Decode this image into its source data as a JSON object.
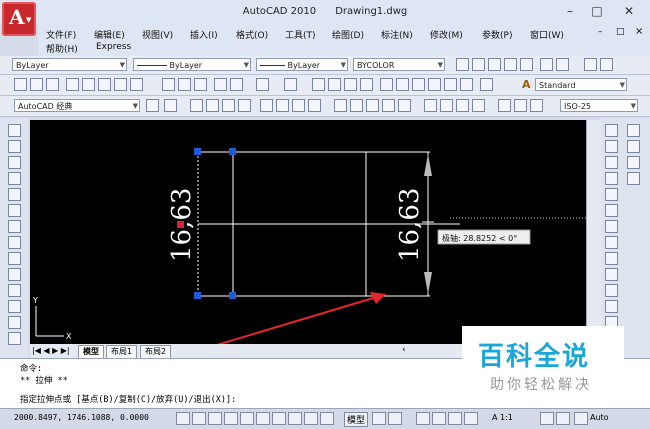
{
  "window": {
    "app_logo_letter": "A",
    "title": "AutoCAD 2010",
    "document": "Drawing1.dwg",
    "btn_minimize": "–",
    "btn_maximize": "□",
    "btn_close": "✕",
    "doc_minimize": "–",
    "doc_restore": "□",
    "doc_close": "×"
  },
  "menu": {
    "items": [
      "文件(F)",
      "编辑(E)",
      "视图(V)",
      "插入(I)",
      "格式(O)",
      "工具(T)",
      "绘图(D)",
      "标注(N)",
      "修改(M)",
      "参数(P)",
      "窗口(W)"
    ],
    "items_row2": [
      "帮助(H)",
      "Express"
    ]
  },
  "toolbar1": {
    "layer_combo": "ByLayer",
    "linetype_combo": "ByLayer",
    "lineweight_combo": "ByLayer",
    "color_combo": "BYCOLOR"
  },
  "toolbar2": {
    "text_style": "Standard"
  },
  "toolbar3": {
    "workspace": "AutoCAD 经典",
    "dim_style": "ISO-25"
  },
  "drawing": {
    "dim_left": "16,63",
    "dim_right": "16,63",
    "tooltip": "极轴: 28.8252 < 0°"
  },
  "tabs": {
    "model": "模型",
    "layout1": "布局1",
    "layout2": "布局2"
  },
  "command": {
    "line1": "命令:",
    "line2": "** 拉伸 **",
    "prompt": "指定拉伸点或 [基点(B)/复制(C)/放弃(U)/退出(X)]:"
  },
  "status": {
    "coords": "2000.8497, 1746.1088, 0.0000",
    "model_btn": "模型",
    "scale": "A 1:1",
    "auto": "Auto"
  },
  "watermark": {
    "title": "百科全说",
    "subtitle": "助你轻松解决"
  }
}
